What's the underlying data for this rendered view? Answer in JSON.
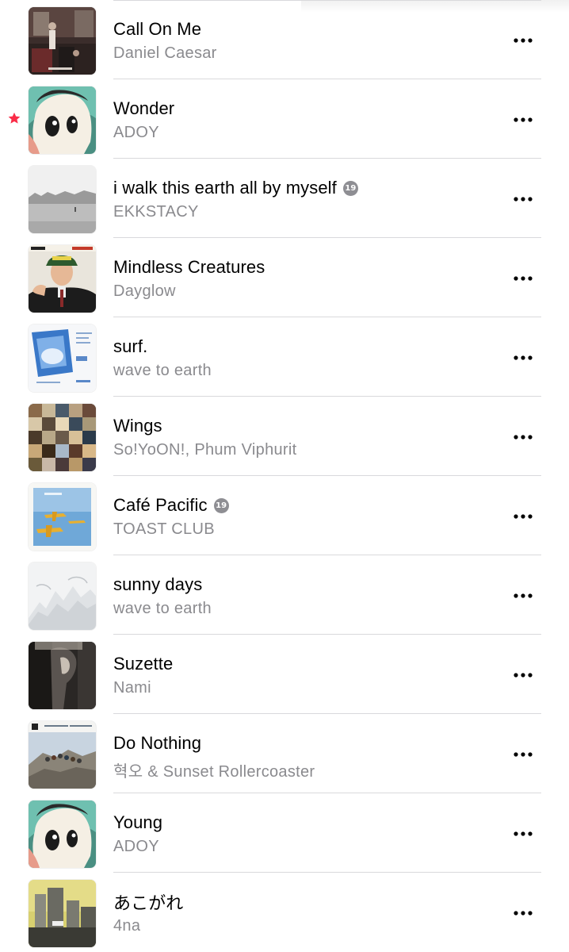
{
  "accent_color": "#fa2d48",
  "songs": [
    {
      "title": "Call On Me",
      "artist": "Daniel Caesar",
      "explicit": false,
      "favorite": false,
      "artwork": "call-on-me-artwork"
    },
    {
      "title": "Wonder",
      "artist": "ADOY",
      "explicit": false,
      "favorite": true,
      "artwork": "adoy-artwork"
    },
    {
      "title": "i walk this earth all by myself",
      "artist": "EKKSTACY",
      "explicit": true,
      "explicit_label": "19",
      "favorite": false,
      "artwork": "ekkstacy-artwork"
    },
    {
      "title": "Mindless Creatures",
      "artist": "Dayglow",
      "explicit": false,
      "favorite": false,
      "artwork": "dayglow-artwork"
    },
    {
      "title": "surf.",
      "artist": "wave to earth",
      "explicit": false,
      "favorite": false,
      "artwork": "surf-artwork"
    },
    {
      "title": "Wings",
      "artist": "So!YoON!, Phum Viphurit",
      "explicit": false,
      "favorite": false,
      "artwork": "wings-artwork"
    },
    {
      "title": "Café Pacific",
      "artist": "TOAST CLUB",
      "explicit": true,
      "explicit_label": "19",
      "favorite": false,
      "artwork": "cafe-pacific-artwork"
    },
    {
      "title": "sunny days",
      "artist": "wave to earth",
      "explicit": false,
      "favorite": false,
      "artwork": "sunny-days-artwork"
    },
    {
      "title": "Suzette",
      "artist": "Nami",
      "explicit": false,
      "favorite": false,
      "artwork": "suzette-artwork"
    },
    {
      "title": "Do Nothing",
      "artist": "혁오 & Sunset Rollercoaster",
      "explicit": false,
      "favorite": false,
      "artwork": "do-nothing-artwork"
    },
    {
      "title": "Young",
      "artist": "ADOY",
      "explicit": false,
      "favorite": false,
      "artwork": "adoy-artwork"
    },
    {
      "title": "あこがれ",
      "artist": "4na",
      "explicit": false,
      "favorite": false,
      "artwork": "akogare-artwork"
    }
  ]
}
